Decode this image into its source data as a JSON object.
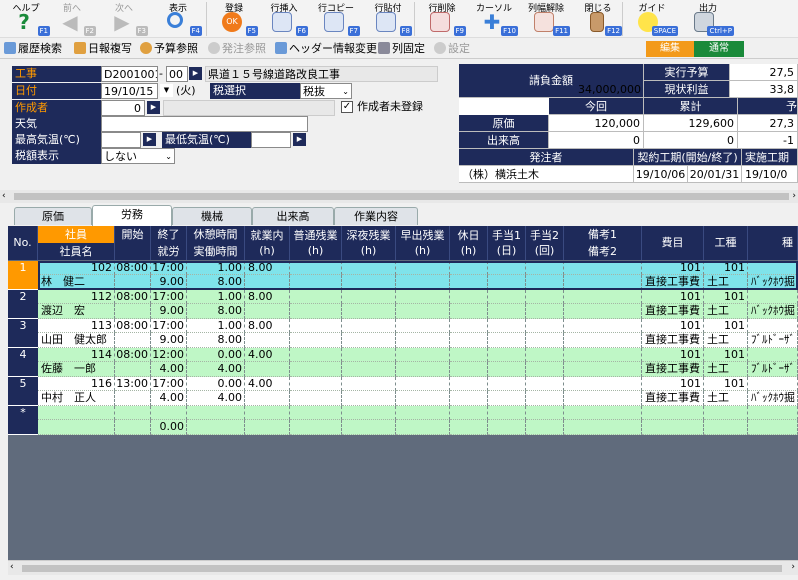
{
  "toolbar": {
    "help": {
      "label": "ヘルプ",
      "key": "F1"
    },
    "prev": {
      "label": "前へ",
      "key": "F2"
    },
    "next": {
      "label": "次へ",
      "key": "F3"
    },
    "display": {
      "label": "表示",
      "key": "F4"
    },
    "register": {
      "label": "登録",
      "key": "F5"
    },
    "row_insert": {
      "label": "行挿入",
      "key": "F6"
    },
    "row_copy": {
      "label": "行コピー",
      "key": "F7"
    },
    "row_paste": {
      "label": "行貼付",
      "key": "F8"
    },
    "row_delete": {
      "label": "行削除",
      "key": "F9"
    },
    "cursor": {
      "label": "カーソル",
      "key": "F10"
    },
    "col_width_reset": {
      "label": "列幅解除",
      "key": "F11"
    },
    "close": {
      "label": "閉じる",
      "key": "F12"
    },
    "guide": {
      "label": "ガイド",
      "key": "SPACE"
    },
    "output": {
      "label": "出力",
      "key": "Ctrl+P"
    }
  },
  "subbar": {
    "history_search": "履歴検索",
    "daily_copy": "日報複写",
    "budget_ref": "予算参照",
    "order_ref": "発注参照",
    "header_change": "ヘッダー情報変更",
    "col_fix": "列固定",
    "settings": "設定",
    "mode_edit": "編集",
    "mode_normal": "通常"
  },
  "form": {
    "koji_label": "工事",
    "koji_code": "D2001001",
    "koji_sep": "-",
    "koji_sub": "00",
    "koji_name": "県道１５号線道路改良工事",
    "date_label": "日付",
    "date_value": "19/10/15",
    "weekday": "(火)",
    "tax_select_label": "税選択",
    "tax_select_value": "税抜",
    "author_label": "作成者",
    "author_value": "0",
    "author_unregistered": "作成者未登録",
    "weather_label": "天気",
    "max_temp_label": "最高気温(℃)",
    "min_temp_label": "最低気温(℃)",
    "tax_display_label": "税額表示",
    "tax_display_value": "しない"
  },
  "summary": {
    "contract_label": "請負金額",
    "contract_value": "34,000,000",
    "exec_budget_label": "実行予算",
    "exec_budget_value": "27,5",
    "current_profit_label": "現状利益",
    "current_profit_value": "33,8",
    "today_label": "今回",
    "cumulative_label": "累計",
    "forecast_label": "予",
    "cost_label": "原価",
    "cost_today": "120,000",
    "cost_cumulative": "129,600",
    "cost_forecast": "27,3",
    "progress_label": "出来高",
    "progress_today": "0",
    "progress_cumulative": "0",
    "progress_forecast": "-1",
    "orderer_label": "発注者",
    "contract_period_label": "契約工期(開始/終了)",
    "actual_period_label": "実施工期",
    "orderer_value": "（株）横浜土木",
    "contract_start": "19/10/06",
    "contract_end": "20/01/31",
    "actual_start": "19/10/0"
  },
  "tabs": [
    "原価",
    "労務",
    "機械",
    "出来高",
    "作業内容"
  ],
  "grid": {
    "headers": {
      "no": "No.",
      "emp_code": "社員",
      "emp_name": "社員名",
      "start": "開始",
      "end": "終了",
      "work": "就労",
      "break": "休憩時間",
      "actual": "実働時間",
      "regular": "就業内\n(h)",
      "normal_ot": "普通残業\n(h)",
      "night_ot": "深夜残業\n(h)",
      "early_ot": "早出残業\n(h)",
      "holiday": "休日\n(h)",
      "allow1": "手当1\n(日)",
      "allow2": "手当2\n(回)",
      "note1": "備考1",
      "note2": "備考2",
      "expense": "費目",
      "process": "工種",
      "extra": "種"
    },
    "rows": [
      {
        "no": "1",
        "code": "102",
        "name": "林　健二",
        "start": "08:00",
        "end": "17:00",
        "work": "9.00",
        "break": "1.00",
        "actual": "8.00",
        "regular": "8.00",
        "exp_code": "101",
        "exp_name": "直接工事費",
        "proc_code": "101",
        "proc_name": "土工",
        "extra": "ﾊﾞｯｸﾎｳ掘"
      },
      {
        "no": "2",
        "code": "112",
        "name": "渡辺　宏",
        "start": "08:00",
        "end": "17:00",
        "work": "9.00",
        "break": "1.00",
        "actual": "8.00",
        "regular": "8.00",
        "exp_code": "101",
        "exp_name": "直接工事費",
        "proc_code": "101",
        "proc_name": "土工",
        "extra": "ﾊﾞｯｸﾎｳ掘"
      },
      {
        "no": "3",
        "code": "113",
        "name": "山田　健太郎",
        "start": "08:00",
        "end": "17:00",
        "work": "9.00",
        "break": "1.00",
        "actual": "8.00",
        "regular": "8.00",
        "exp_code": "101",
        "exp_name": "直接工事費",
        "proc_code": "101",
        "proc_name": "土工",
        "extra": "ﾌﾞﾙﾄﾞｰｻﾞ"
      },
      {
        "no": "4",
        "code": "114",
        "name": "佐藤　一郎",
        "start": "08:00",
        "end": "12:00",
        "work": "4.00",
        "break": "0.00",
        "actual": "4.00",
        "regular": "4.00",
        "exp_code": "101",
        "exp_name": "直接工事費",
        "proc_code": "101",
        "proc_name": "土工",
        "extra": "ﾌﾞﾙﾄﾞｰｻﾞ"
      },
      {
        "no": "5",
        "code": "116",
        "name": "中村　正人",
        "start": "13:00",
        "end": "17:00",
        "work": "4.00",
        "break": "0.00",
        "actual": "4.00",
        "regular": "4.00",
        "exp_code": "101",
        "exp_name": "直接工事費",
        "proc_code": "101",
        "proc_name": "土工",
        "extra": "ﾊﾞｯｸﾎｳ掘"
      }
    ],
    "new_row": {
      "no": "*",
      "work": "0.00"
    }
  },
  "colors": {
    "header": "#1e2a5a",
    "orange": "#ff9900",
    "cyan": "#7fe3ea",
    "green": "#bff7c6"
  }
}
